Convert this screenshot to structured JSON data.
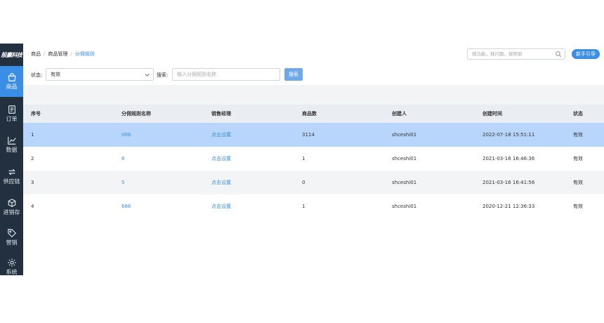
{
  "sidebar": {
    "logo": "股赢科技",
    "items": [
      {
        "label": "商品",
        "icon": "bag-icon"
      },
      {
        "label": "订单",
        "icon": "document-icon"
      },
      {
        "label": "数据",
        "icon": "line-chart-icon"
      },
      {
        "label": "供应链",
        "icon": "exchange-icon"
      },
      {
        "label": "进销存",
        "icon": "package-icon"
      },
      {
        "label": "营销",
        "icon": "tag-icon"
      },
      {
        "label": "系统",
        "icon": "gear-icon"
      }
    ]
  },
  "header": {
    "breadcrumb": [
      "商品",
      "商品管理",
      "分佣规则"
    ],
    "search_placeholder": "搜功能，搜问题，搜帮助",
    "guide_button": "新手引导"
  },
  "filters": {
    "status_label": "状态:",
    "status_value": "有效",
    "search_label": "搜索:",
    "search_placeholder": "输入分佣规则名称",
    "search_button": "搜索"
  },
  "table": {
    "columns": [
      "序号",
      "分佣规则名称",
      "销售经理",
      "商品数",
      "创建人",
      "创建时间",
      "状态"
    ],
    "rows": [
      {
        "index": "1",
        "name": "006",
        "manager": "点击设置",
        "count": "3114",
        "creator": "shceshi01",
        "created": "2022-07-18 15:51:11",
        "status": "有效"
      },
      {
        "index": "2",
        "name": "6",
        "manager": "点击设置",
        "count": "1",
        "creator": "shceshi01",
        "created": "2021-03-16 16:46:36",
        "status": "有效"
      },
      {
        "index": "3",
        "name": "5",
        "manager": "点击设置",
        "count": "0",
        "creator": "shceshi01",
        "created": "2021-03-16 16:41:56",
        "status": "有效"
      },
      {
        "index": "4",
        "name": "666",
        "manager": "点击设置",
        "count": "1",
        "creator": "shceshi01",
        "created": "2020-12-21 12:36:33",
        "status": "有效"
      }
    ]
  },
  "colors": {
    "sidebar_bg": "#23303f",
    "accent": "#3a8ee6",
    "selected_row": "#b8d6fb"
  }
}
